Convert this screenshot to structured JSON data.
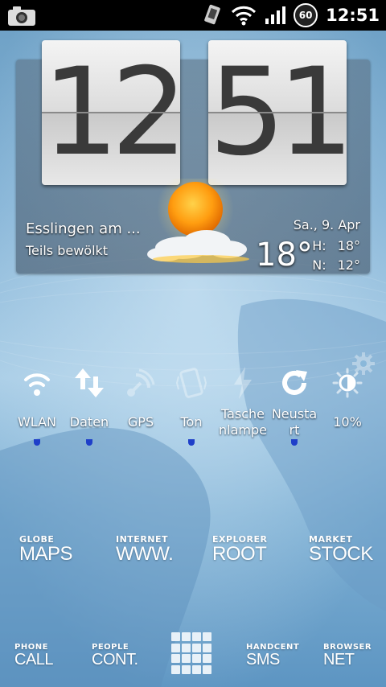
{
  "status_bar": {
    "time": "12:51",
    "battery": "60",
    "icons": [
      "camera-icon",
      "sync-icon",
      "wifi-icon",
      "signal-icon",
      "battery-icon"
    ]
  },
  "clock": {
    "hour": "12",
    "minute": "51"
  },
  "weather": {
    "location": "Esslingen am ...",
    "condition": "Teils bewölkt",
    "date": "Sa., 9. Apr",
    "temperature": "18°",
    "high_label": "H:",
    "high": "18°",
    "low_label": "N:",
    "low": "12°",
    "icon": "partly-cloudy-sun-icon"
  },
  "toggles": [
    {
      "label": "WLAN",
      "icon": "wifi-icon",
      "on": true
    },
    {
      "label": "Daten",
      "icon": "data-transfer-icon",
      "on": true
    },
    {
      "label": "GPS",
      "icon": "gps-icon",
      "on": false
    },
    {
      "label": "Ton",
      "icon": "vibrate-icon",
      "on": true
    },
    {
      "label": "Tasche nlampe",
      "icon": "flash-icon",
      "on": false
    },
    {
      "label": "Neusta rt",
      "icon": "restart-icon",
      "on": true
    },
    {
      "label": "10%",
      "icon": "brightness-icon",
      "on": false
    }
  ],
  "shortcuts": [
    {
      "small": "GLOBE",
      "big": "MAPS"
    },
    {
      "small": "INTERNET",
      "big": "WWW."
    },
    {
      "small": "EXPLORER",
      "big": "ROOT"
    },
    {
      "small": "MARKET",
      "big": "STOCK"
    }
  ],
  "dock": [
    {
      "small": "PHONE",
      "big": "CALL"
    },
    {
      "small": "PEOPLE",
      "big": "CONT."
    },
    {
      "small": "HANDCENT",
      "big": "SMS"
    },
    {
      "small": "BROWSER",
      "big": "NET"
    }
  ]
}
